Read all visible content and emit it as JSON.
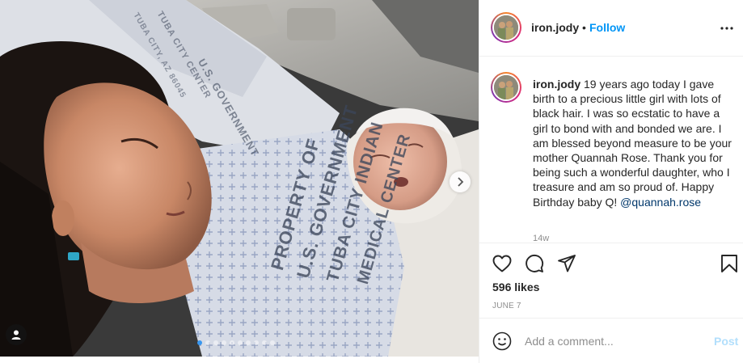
{
  "media": {
    "printed_text": [
      "PROPERTY OF",
      "U.S. GOVERNMENT",
      "TUBA CITY INDIAN",
      "MEDICAL CENTER",
      "U.S. GOVERNMENT",
      "TUBA CITY CENTER",
      "TUBA CITY, AZ 86045"
    ],
    "dot_count": 10,
    "active_dot": 0
  },
  "header": {
    "username": "iron.jody",
    "separator": "•",
    "follow_label": "Follow"
  },
  "caption": {
    "username": "iron.jody",
    "text": " 19 years ago today I gave birth to a precious little girl with lots of black hair. I was so ecstatic to have a girl to bond with and bonded we are. I am blessed beyond measure to be your mother Quannah Rose. Thank you for being such a wonderful daughter, who I treasure and am so proud of. Happy Birthday baby Q! ",
    "mention": "@quannah.rose",
    "time": "14w"
  },
  "actions": {
    "likes": "596 likes",
    "date": "JUNE 7"
  },
  "comment_box": {
    "placeholder": "Add a comment...",
    "post_label": "Post"
  },
  "icons": {
    "more": "more-horizontal-icon",
    "like": "heart-icon",
    "comment": "comment-bubble-icon",
    "share": "paper-plane-icon",
    "save": "bookmark-icon",
    "emoji": "smiley-icon",
    "next": "chevron-right-icon",
    "tag": "user-tag-icon"
  },
  "colors": {
    "accent": "#0095f6",
    "post_disabled": "#b2dffc",
    "carousel_active": "#3897f0"
  }
}
